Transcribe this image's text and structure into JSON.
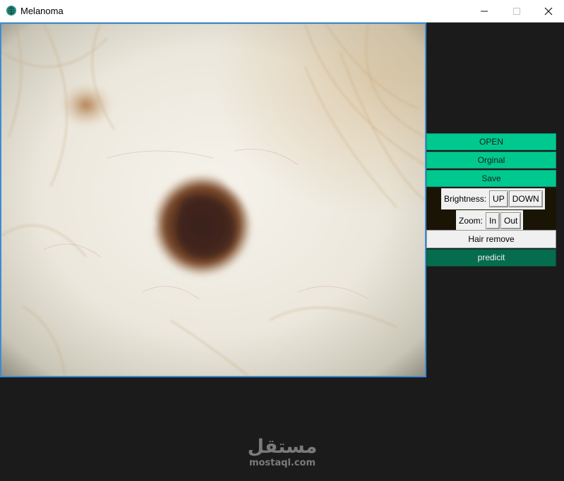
{
  "window": {
    "title": "Melanoma",
    "icon": "brain-icon",
    "controls": {
      "minimize": "—",
      "maximize": "☐",
      "close": "✕"
    }
  },
  "image": {
    "description_icon": "dermoscopy-image",
    "border_color": "#3d8bd3"
  },
  "panel": {
    "open_label": "OPEN",
    "orginal_label": "Orginal",
    "save_label": "Save",
    "brightness_label": "Brightness:",
    "brightness_up": "UP",
    "brightness_down": "DOWN",
    "zoom_label": "Zoom:",
    "zoom_in": "In",
    "zoom_out": "Out",
    "hair_remove_label": "Hair remove",
    "predict_label": "predicit"
  },
  "colors": {
    "accent": "#00c98f",
    "predict": "#066c4e",
    "background": "#1b1b1b"
  },
  "watermark": {
    "arabic": "مستقل",
    "latin": "mostaql.com"
  }
}
